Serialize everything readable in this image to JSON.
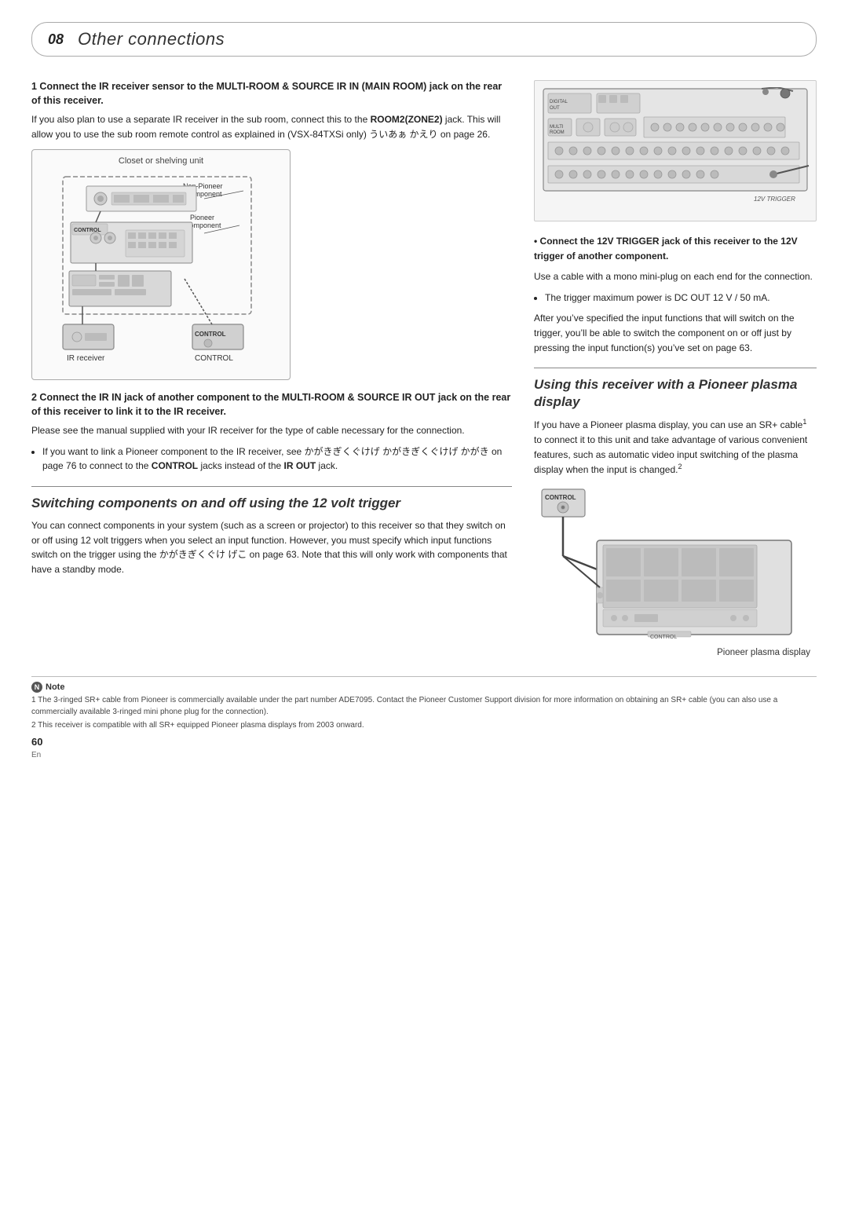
{
  "header": {
    "chapter_number": "08",
    "chapter_title": "Other connections"
  },
  "left_col": {
    "step1_heading": "1   Connect the IR receiver sensor to the MULTI-ROOM & SOURCE IR IN (MAIN ROOM) jack on the rear of this receiver.",
    "step1_body": "If you also plan to use a separate IR receiver in the sub room, connect this to the ROOM2(ZONE2) jack. This will allow you to use the sub room remote control as explained in (VSX-84TXSi only) ã…§ã…¦ã…¥ã…¤ã…¢ã…³ã…°ã…² on page 26.",
    "diagram_label": "Closet or shelving unit",
    "diagram_sublabel1": "Non-Pioneer component",
    "diagram_sublabel2": "Pioneer component",
    "diagram_ir_label": "IR receiver",
    "diagram_control_label": "CONTROL",
    "step2_heading": "2   Connect the IR IN jack of another component to the MULTI-ROOM & SOURCE IR OUT jack on the rear of this receiver to link it to the IR receiver.",
    "step2_body": "Please see the manual supplied with your IR receiver for the type of cable necessary for the connection.",
    "step2_bullet": "If you want to link a Pioneer component to the IR receiver, see ã…§ã…¦ã…¥ã…¤ã…¢ã…³ã…°ã…² ã…§ã…¦ã…¥ã…¤ã…¢ã…³ã…°ã…² ã…§ã…¦ã…¥ on page 76 to connect to the CONTROL jacks instead of the IR OUT jack.",
    "switching_title": "Switching components on and off using the 12 volt trigger",
    "switching_body1": "You can connect components in your system (such as a screen or projector) to this receiver so that they switch on or off using 12 volt triggers when you select an input function. However, you must specify which input functions switch on the trigger using the ã…§ã…¦ã…¥ã…¤ã…¢ã…³   ã…°ã…²  on page 63. Note that this will only work with components that have a standby mode."
  },
  "right_col": {
    "trigger_bullet_heading": "Connect the 12V TRIGGER jack of this receiver to the 12V trigger of another component.",
    "trigger_body": "Use a cable with a mono mini-plug on each end for the connection.",
    "trigger_bullet": "The trigger maximum power is DC OUT 12 V / 50 mA.",
    "trigger_body2": "After you’ve specified the input functions that will switch on the trigger, you’ll be able to switch the component on or off just by pressing the input function(s) you’ve set on page 63.",
    "plasma_section_title": "Using this receiver with a Pioneer plasma display",
    "plasma_body1": "If you have a Pioneer plasma display, you can use an SR+ cable",
    "plasma_superscript1": "1",
    "plasma_body2": " to connect it to this unit and take advantage of various convenient features, such as automatic video input switching of the plasma display when the input is changed.",
    "plasma_superscript2": "2",
    "plasma_diagram_label": "Pioneer plasma display"
  },
  "footer": {
    "note_label": "Note",
    "footnote1": "1  The 3-ringed SR+ cable from Pioneer is commercially available under the part number ADE7095. Contact the Pioneer Customer Support division for more information on obtaining an SR+ cable (you can also use a commercially available 3-ringed mini phone plug for the connection).",
    "footnote2": "2  This receiver is compatible with all SR+ equipped Pioneer plasma displays from 2003 onward.",
    "page_number": "60",
    "lang": "En"
  }
}
